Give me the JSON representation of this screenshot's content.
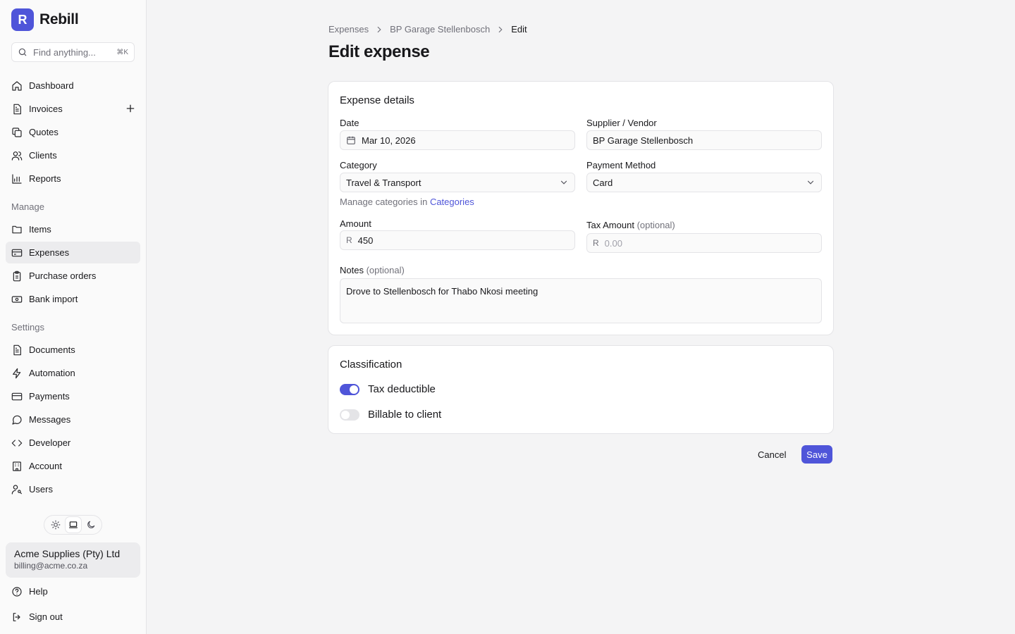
{
  "app": {
    "logo_letter": "R",
    "name": "Rebill",
    "accent": "#4f55d9"
  },
  "search": {
    "placeholder": "Find anything...",
    "shortcut": "⌘K"
  },
  "sidebar": {
    "main_items": [
      {
        "label": "Dashboard",
        "icon": "home-icon"
      },
      {
        "label": "Invoices",
        "icon": "file-text-icon"
      },
      {
        "label": "Quotes",
        "icon": "copy-icon"
      },
      {
        "label": "Clients",
        "icon": "users-icon"
      },
      {
        "label": "Reports",
        "icon": "bar-chart-icon"
      }
    ],
    "manage_heading": "Manage",
    "manage_items": [
      {
        "label": "Items",
        "icon": "folder-icon"
      },
      {
        "label": "Expenses",
        "icon": "credit-card-icon",
        "active": true
      },
      {
        "label": "Purchase orders",
        "icon": "clipboard-icon"
      },
      {
        "label": "Bank import",
        "icon": "banknote-icon"
      }
    ],
    "settings_heading": "Settings",
    "settings_items": [
      {
        "label": "Documents",
        "icon": "file-text-icon"
      },
      {
        "label": "Automation",
        "icon": "zap-icon"
      },
      {
        "label": "Payments",
        "icon": "credit-card-icon"
      },
      {
        "label": "Messages",
        "icon": "message-circle-icon"
      },
      {
        "label": "Developer",
        "icon": "code-icon"
      },
      {
        "label": "Account",
        "icon": "building-icon"
      },
      {
        "label": "Users",
        "icon": "user-key-icon"
      }
    ],
    "theme_options": [
      "light",
      "system",
      "dark"
    ],
    "theme_selected": "system",
    "account": {
      "name": "Acme Supplies (Pty) Ltd",
      "email": "billing@acme.co.za"
    },
    "help_label": "Help",
    "signout_label": "Sign out"
  },
  "breadcrumb": {
    "items": [
      "Expenses",
      "BP Garage Stellenbosch",
      "Edit"
    ]
  },
  "page_title": "Edit expense",
  "details": {
    "title": "Expense details",
    "date_label": "Date",
    "date_value": "Mar 10, 2026",
    "supplier_label": "Supplier / Vendor",
    "supplier_value": "BP Garage Stellenbosch",
    "category_label": "Category",
    "category_value": "Travel & Transport",
    "category_help": "Manage categories in",
    "category_help_link": "Categories",
    "payment_label": "Payment Method",
    "payment_value": "Card",
    "amount_label": "Amount",
    "currency_prefix": "R",
    "amount_value": "450",
    "tax_label": "Tax Amount",
    "optional": "(optional)",
    "tax_placeholder": "0.00",
    "notes_label": "Notes",
    "notes_value": "Drove to Stellenbosch for Thabo Nkosi meeting"
  },
  "classification": {
    "title": "Classification",
    "tax_deductible_label": "Tax deductible",
    "tax_deductible_on": true,
    "billable_label": "Billable to client",
    "billable_on": false
  },
  "actions": {
    "cancel": "Cancel",
    "save": "Save"
  }
}
